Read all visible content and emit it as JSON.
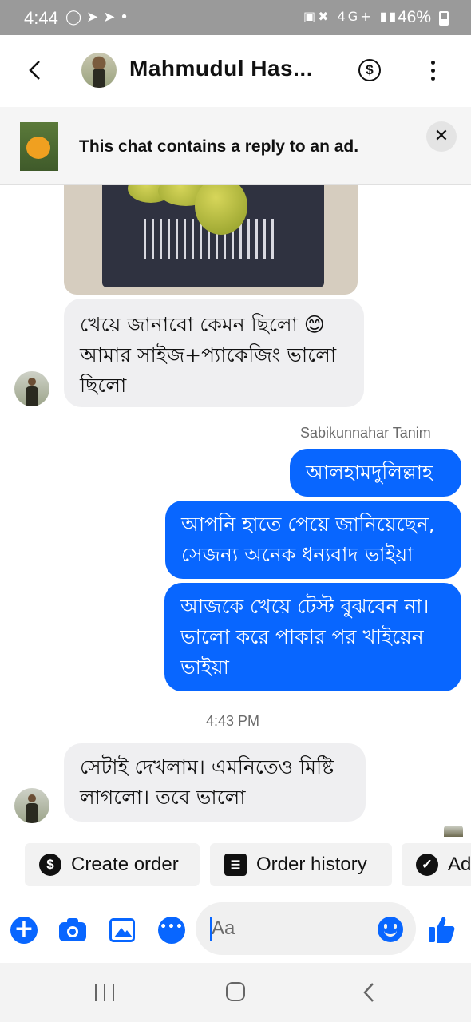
{
  "status_bar": {
    "time": "4:44",
    "network": "4G+",
    "battery": "46%"
  },
  "header": {
    "contact_name": "Mahmudul Has...",
    "payment_symbol": "$"
  },
  "ad_banner": {
    "text": "This chat contains a reply to an ad.",
    "close_symbol": "✕"
  },
  "messages": [
    {
      "id": "m1",
      "direction": "in",
      "text_line1": "খেয়ে জানাবো কেমন ছিলো 😊",
      "text_line2": "আমার সাইজ+প্যাকেজিং ভালো",
      "text_line3": "ছিলো"
    },
    {
      "id": "m2",
      "direction": "out",
      "text_line1": "আলহামদুলিল্লাহ"
    },
    {
      "id": "m3",
      "direction": "out",
      "text_line1": "আপনি হাতে পেয়ে জানিয়েছেন,",
      "text_line2": "সেজন্য অনেক ধন্যবাদ ভাইয়া"
    },
    {
      "id": "m4",
      "direction": "out",
      "text_line1": "আজকে খেয়ে টেস্ট বুঝবেন না।",
      "text_line2": "ভালো করে পাকার পর খাইয়েন",
      "text_line3": "ভাইয়া"
    },
    {
      "id": "m5",
      "direction": "in",
      "text_line1": "সেটাই দেখলাম। এমনিতেও মিষ্টি",
      "text_line2": "লাগলো। তবে ভালো"
    }
  ],
  "sender_label": "Sabikunnahar Tanim",
  "timestamp": "4:43 PM",
  "quick_actions": [
    {
      "label": "Create order",
      "icon": "dollar-circle-icon",
      "glyph": "$"
    },
    {
      "label": "Order history",
      "icon": "receipt-list-icon",
      "glyph": "☰"
    },
    {
      "label": "Ad",
      "icon": "check-circle-icon",
      "glyph": "✓"
    }
  ],
  "composer": {
    "placeholder": "Aa"
  },
  "colors": {
    "accent": "#0866ff",
    "incoming_bubble": "#efeff1",
    "status_bar": "#9a9a9a"
  }
}
